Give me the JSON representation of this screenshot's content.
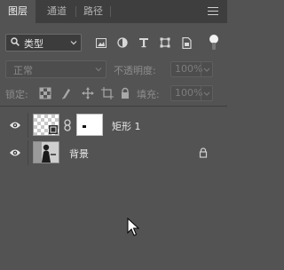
{
  "tabs": [
    {
      "label": "图层",
      "active": true
    },
    {
      "label": "通道",
      "active": false
    },
    {
      "label": "路径",
      "active": false
    }
  ],
  "menu_icon": "hamburger-menu-icon",
  "filter": {
    "kind_label": "类型",
    "icons": [
      "search-icon",
      "pixel-layer-filter-icon",
      "adjustment-filter-icon",
      "type-filter-icon",
      "shape-filter-icon",
      "smart-object-filter-icon",
      "filter-toggle"
    ]
  },
  "blend": {
    "mode": "正常",
    "opacity_label": "不透明度:",
    "opacity_value": "100%"
  },
  "locks": {
    "label": "锁定:",
    "icons": [
      "lock-transparent-icon",
      "lock-image-icon",
      "lock-position-icon",
      "lock-artboard-icon",
      "lock-all-icon"
    ],
    "fill_label": "填充:",
    "fill_value": "100%"
  },
  "layers": [
    {
      "name": "矩形 1",
      "visible": true,
      "type": "shape",
      "has_mask": true
    },
    {
      "name": "背景",
      "visible": true,
      "type": "background",
      "locked": true
    }
  ],
  "colors": {
    "panel": "#535353",
    "tabbar": "#3e3e3e",
    "text": "#d6d6d6"
  }
}
